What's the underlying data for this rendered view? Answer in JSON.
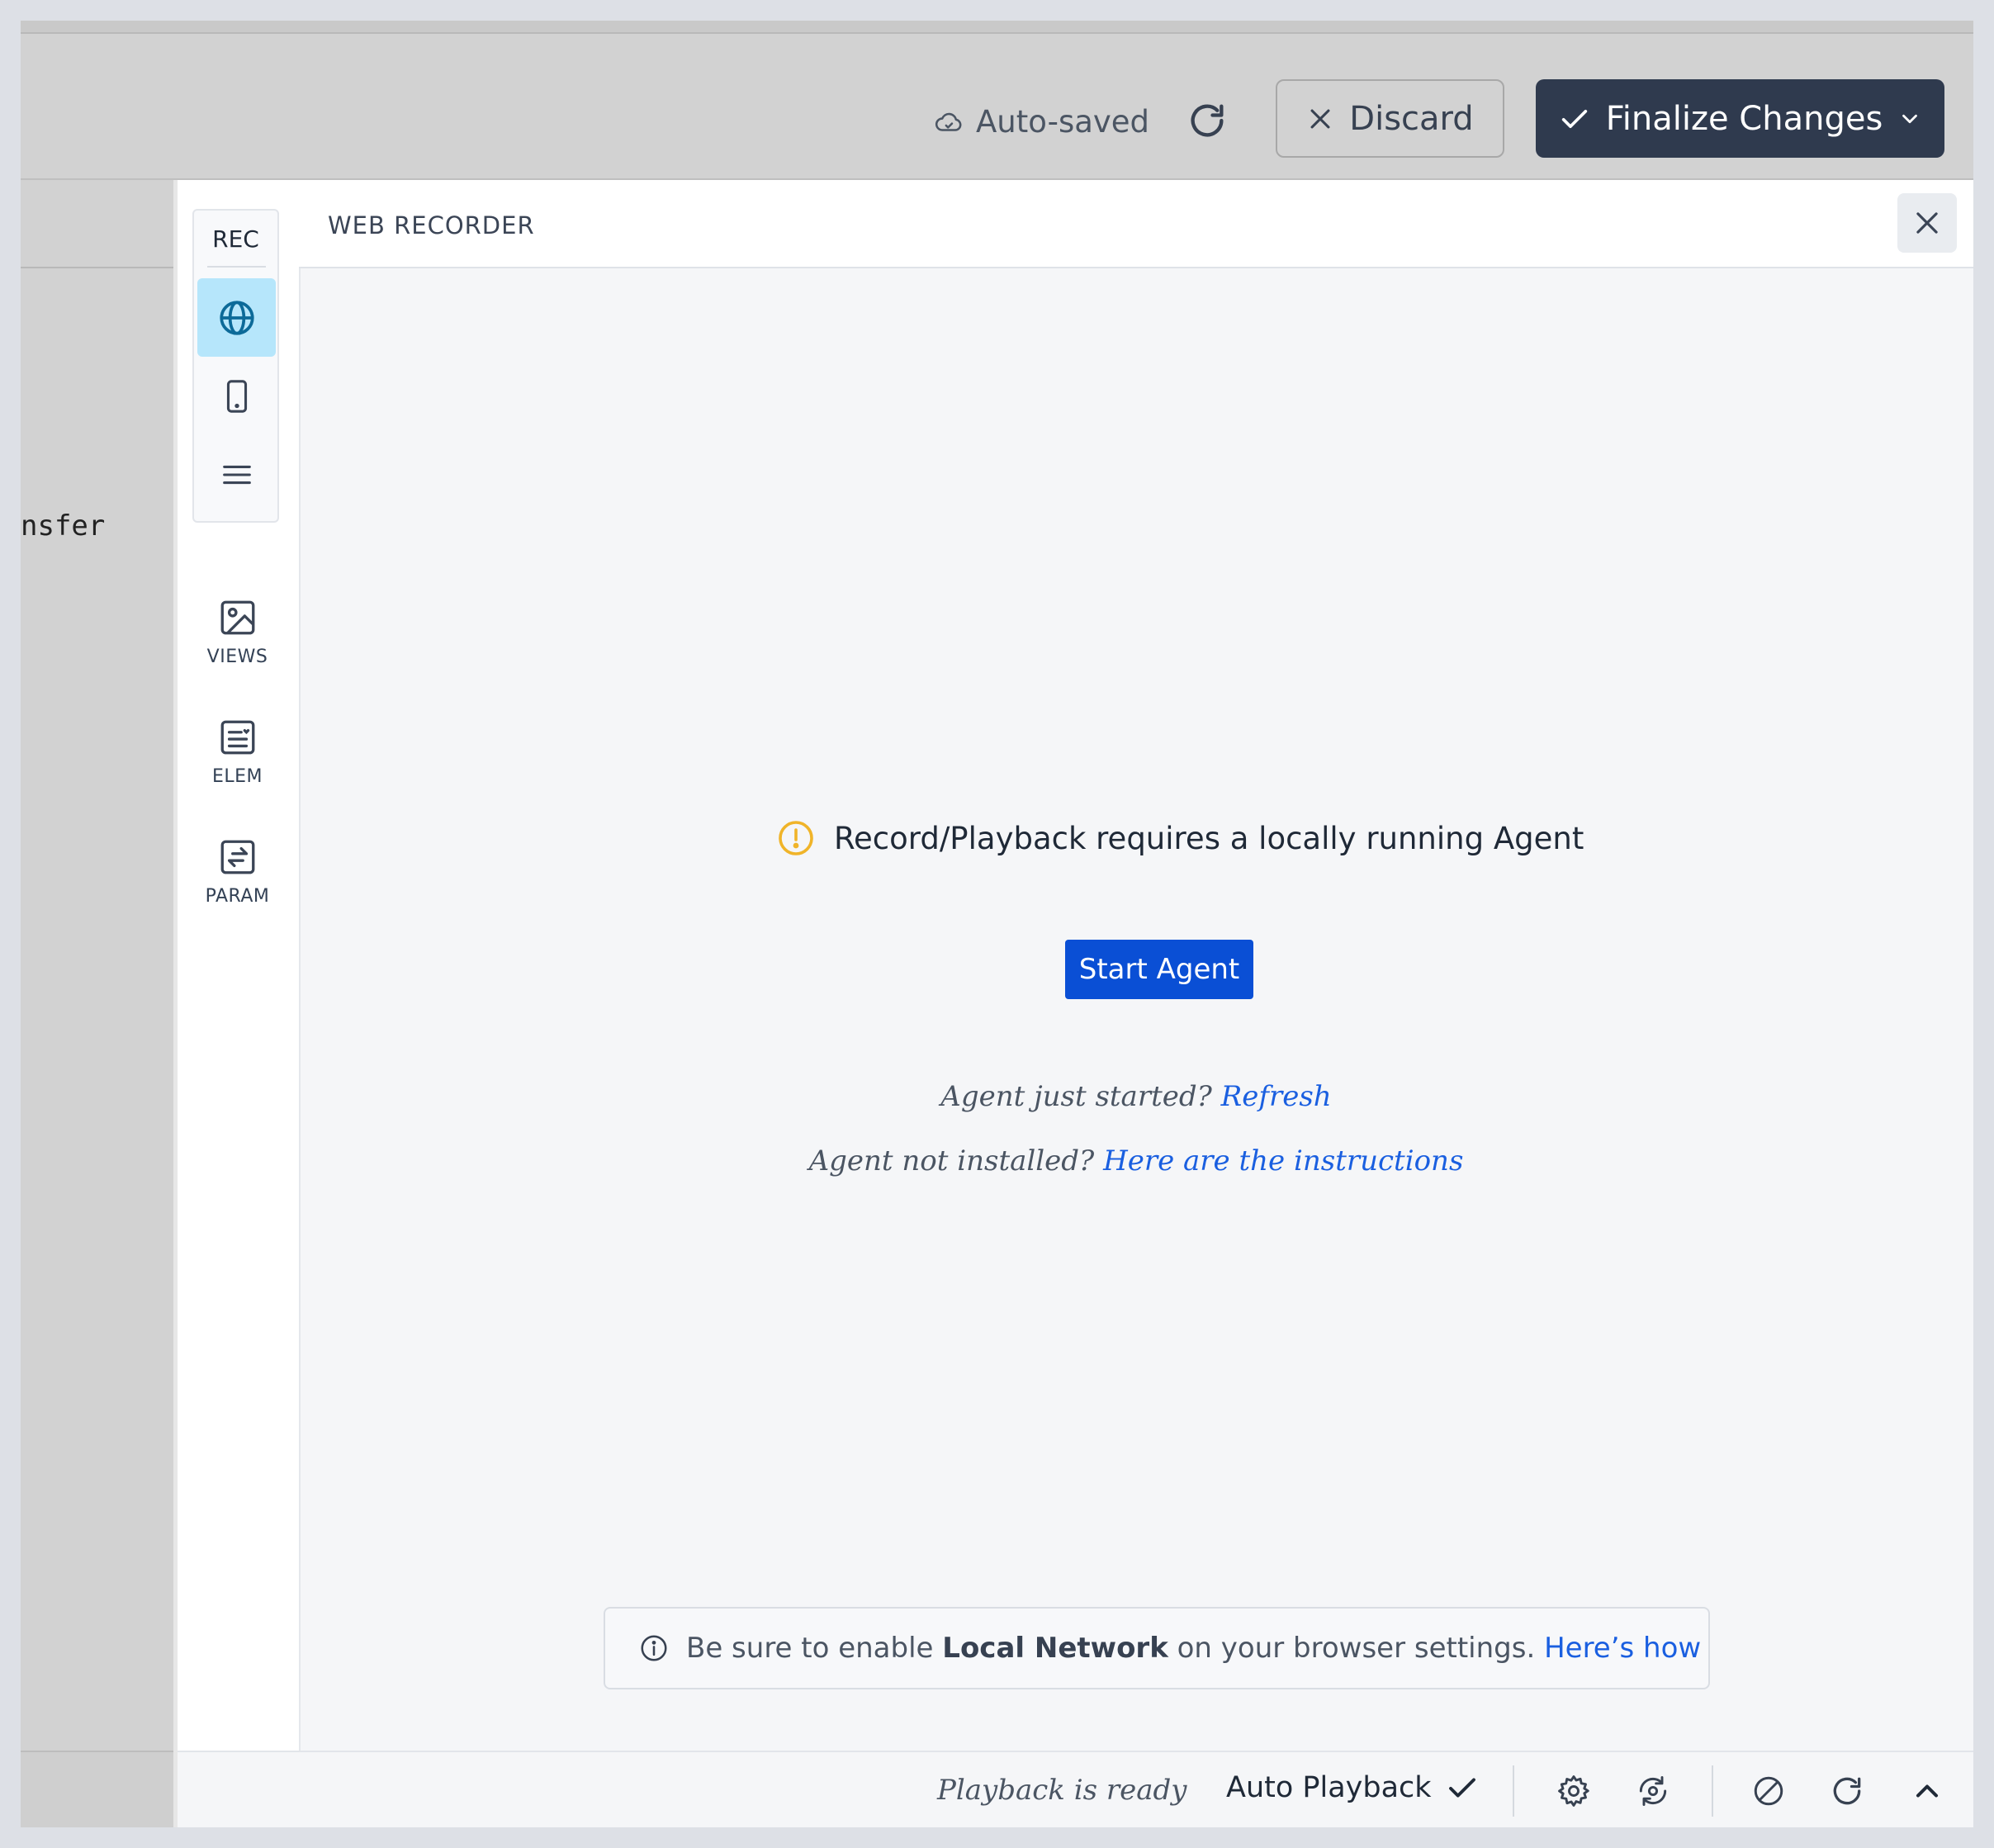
{
  "topbar": {
    "autosaved_label": "Auto-saved",
    "discard_label": "Discard",
    "finalize_label": "Finalize Changes"
  },
  "background": {
    "code_fragment": "nsfer"
  },
  "rail": {
    "rec_label": "REC",
    "views_label": "VIEWS",
    "elem_label": "ELEM",
    "param_label": "PARAM"
  },
  "panel": {
    "title": "WEB RECORDER",
    "warning_message": "Record/Playback requires a locally running Agent",
    "start_agent_label": "Start Agent",
    "hint1_text": "Agent just started?",
    "hint1_link": "Refresh",
    "hint2_text": "Agent not installed?",
    "hint2_link": "Here are the instructions"
  },
  "notice": {
    "prefix": "Be sure to enable",
    "bold": "Local Network",
    "suffix": "on your browser settings.",
    "link": "Here’s how"
  },
  "footer": {
    "status": "Playback is ready",
    "auto_playback_label": "Auto Playback"
  },
  "colors": {
    "primary_dark": "#2f3a4e",
    "primary_blue": "#0a4fd5",
    "link_blue": "#1a5fe0",
    "warning": "#f0b429",
    "active_tab": "#b6e6fb"
  }
}
